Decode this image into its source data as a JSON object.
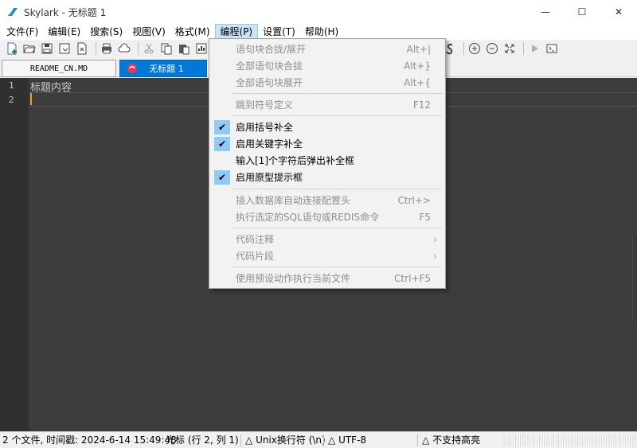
{
  "window": {
    "title": "Skylark - 无标题 1",
    "controls": {
      "minimize": "—",
      "maximize": "☐",
      "close": "✕"
    }
  },
  "menubar": [
    "文件(F)",
    "编辑(E)",
    "搜索(S)",
    "视图(V)",
    "格式(M)",
    "编程(P)",
    "设置(T)",
    "帮助(H)"
  ],
  "menubar_active_index": 5,
  "tabs": [
    {
      "label": "README_CN.MD",
      "active": false
    },
    {
      "label": "无标题 1",
      "active": true
    }
  ],
  "editor": {
    "lines": [
      {
        "number": "1",
        "text": "标题内容"
      },
      {
        "number": "2",
        "text": ""
      }
    ]
  },
  "dropdown": {
    "items": [
      {
        "label": "语句块合拢/展开",
        "shortcut": "Alt+|",
        "checked": false,
        "disabled": true
      },
      {
        "label": "全部语句块合拢",
        "shortcut": "Alt+}",
        "checked": false,
        "disabled": true
      },
      {
        "label": "全部语句块展开",
        "shortcut": "Alt+{",
        "checked": false,
        "disabled": true
      },
      {
        "label": "跳到符号定义",
        "shortcut": "F12",
        "checked": false,
        "disabled": true
      },
      {
        "label": "启用括号补全",
        "shortcut": "",
        "checked": true,
        "disabled": false
      },
      {
        "label": "启用关键字补全",
        "shortcut": "",
        "checked": true,
        "disabled": false
      },
      {
        "label": "输入[1]个字符后弹出补全框",
        "shortcut": "",
        "checked": false,
        "disabled": false
      },
      {
        "label": "启用原型提示框",
        "shortcut": "",
        "checked": true,
        "disabled": false
      },
      {
        "label": "插入数据库自动连接配置头",
        "shortcut": "Ctrl+>",
        "checked": false,
        "disabled": true
      },
      {
        "label": "执行选定的SQL语句或REDIS命令",
        "shortcut": "F5",
        "checked": false,
        "disabled": true
      },
      {
        "label": "代码注释",
        "shortcut": "",
        "submenu": true,
        "checked": false,
        "disabled": true
      },
      {
        "label": "代码片段",
        "shortcut": "",
        "submenu": true,
        "checked": false,
        "disabled": true
      },
      {
        "label": "使用预设动作执行当前文件",
        "shortcut": "Ctrl+F5",
        "checked": false,
        "disabled": true
      }
    ],
    "submenu_arrow": "›",
    "check_mark": "✔"
  },
  "statusbar": {
    "file_info": "2 个文件, 时间戳: 2024-6-14 15:49:48",
    "cursor": "光标 (行 2, 列 1)",
    "line_ending": "Unix换行符 (\\n)",
    "encoding": "UTF-8",
    "highlight": "不支持高亮",
    "triangle": "△"
  },
  "colors": {
    "accent": "#0078d7",
    "check_bg": "#91c9f7",
    "editor_bg": "#3c3c3c",
    "caret": "#f0a020"
  }
}
